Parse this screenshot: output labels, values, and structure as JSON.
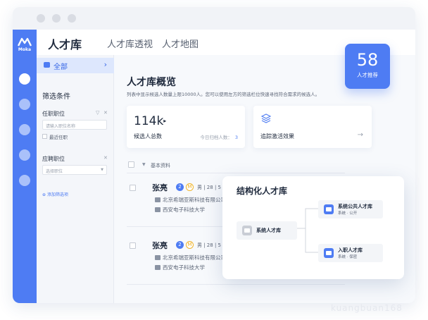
{
  "app": {
    "logo_text": "Moka"
  },
  "nav": {
    "tabs": [
      {
        "label": "人才库",
        "active": true
      },
      {
        "label": "人才库透视",
        "active": false
      },
      {
        "label": "人才地图",
        "active": false
      }
    ]
  },
  "filter": {
    "all_label": "全部",
    "title": "筛选条件",
    "position": {
      "label": "任职职位",
      "placeholder": "请输入职位名称",
      "checkbox_label": "最近任职"
    },
    "applied": {
      "label": "应聘职位",
      "select_placeholder": "选择职位"
    },
    "add_label": "添加筛选项"
  },
  "overview": {
    "title": "人才库概览",
    "description": "列表中显示候选人数量上限10000人。您可以使用左方的筛选栏位快速寻找符合需求的候选人。",
    "total": {
      "value": "114k",
      "label": "候选人总数",
      "today_label": "今日归档人数：",
      "today_value": "3"
    },
    "track": {
      "label": "追踪激活效果"
    }
  },
  "recommend": {
    "count": "58",
    "label": "人才推荐"
  },
  "table": {
    "header": "基本资料",
    "rows": [
      {
        "name": "张亮",
        "tag1": "2",
        "tag2": "M",
        "meta": "男 | 28 | 5",
        "company": "北京希瑞亚斯科技有限公司",
        "school": "西安电子科技大学"
      },
      {
        "name": "张亮",
        "tag1": "2",
        "tag2": "M",
        "meta": "男 | 28 | 5",
        "company": "北京希瑞亚斯科技有限公司",
        "school": "西安电子科技大学"
      }
    ]
  },
  "popup": {
    "title": "结构化人才库",
    "root": "系统人才库",
    "public": {
      "title": "系统公共人才库",
      "sub": "系统 · 公开"
    },
    "hired": {
      "title": "入职人才库",
      "sub": "系统 · 保密"
    }
  },
  "watermark": "kuangbuan168"
}
